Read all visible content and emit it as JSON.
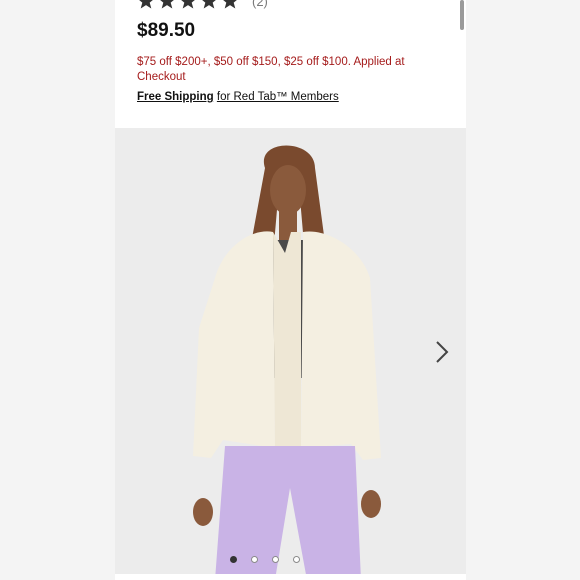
{
  "product": {
    "rating_stars": 5,
    "review_count": "(2)",
    "price": "$89.50",
    "promo": "$75 off $200+, $50 off $150, $25 off $100. Applied at Checkout",
    "shipping_link": "Free Shipping",
    "shipping_rest": "for Red Tab™ Members"
  },
  "gallery": {
    "image_count": 4,
    "active_index": 0,
    "next_icon": "chevron-right-icon"
  },
  "colors": {
    "promo_red": "#a51c1c",
    "star_color": "#333333"
  }
}
